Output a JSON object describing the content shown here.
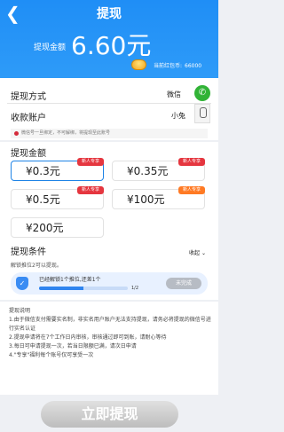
{
  "header": {
    "back_icon": "back-arrow-icon",
    "title": "提现",
    "amount_label": "提现金额",
    "amount": "6.60元",
    "balance_label": "当前红包币:",
    "balance_value": "66000"
  },
  "method": {
    "label": "提现方式",
    "value": "微信"
  },
  "account": {
    "label": "收款账户",
    "value": "小兔"
  },
  "notice": "微信号一旦绑定，不可解绑，将提现至此账号",
  "amount_section": {
    "title": "提现金额",
    "options": [
      {
        "label": "¥0.3元",
        "tag": "新人专享",
        "selected": true,
        "tag_color": "#e5363f"
      },
      {
        "label": "¥0.35元",
        "tag": "新人专享",
        "selected": false,
        "tag_color": "#e5363f"
      },
      {
        "label": "¥0.5元",
        "tag": "新人专享",
        "selected": false,
        "tag_color": "#e5363f"
      },
      {
        "label": "¥100元",
        "tag": "新人专享",
        "selected": false,
        "tag_color": "#ff7a24"
      },
      {
        "label": "¥200元",
        "tag": "",
        "selected": false,
        "tag_color": ""
      }
    ]
  },
  "conditions": {
    "title": "提现条件",
    "collapse": "收起",
    "sub": "解锁推位2可以提现。",
    "text": "已经解锁1个推位,还差1个",
    "progress": 0.5,
    "progress_text": "1/2",
    "status": "未完成"
  },
  "description": {
    "title": "提现说明",
    "lines": [
      "1.由于微信支付需要实名制，非实名用户账户无法支持提现，请务必将提现的微信号进行实名认证",
      "2.提现申请将在7个工作日内审核，审核通过即可到账，请耐心等待",
      "3.每日可申请提现一次，若当日限额已满，请次日申请",
      "4.\"专享\"福利每个账号仅可享受一次"
    ]
  },
  "submit_label": "立即提现"
}
